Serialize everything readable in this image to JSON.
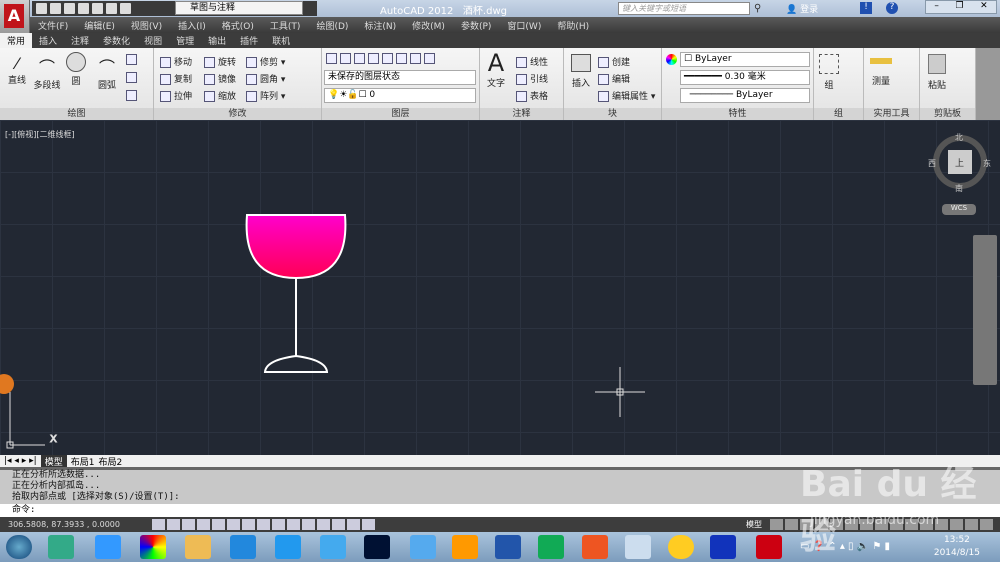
{
  "title": {
    "app": "AutoCAD 2012",
    "file": "酒杯.dwg",
    "workspace": "草图与注释",
    "search_placeholder": "键入关键字或短语",
    "login": "登录"
  },
  "menu": [
    "文件(F)",
    "编辑(E)",
    "视图(V)",
    "插入(I)",
    "格式(O)",
    "工具(T)",
    "绘图(D)",
    "标注(N)",
    "修改(M)",
    "参数(P)",
    "窗口(W)",
    "帮助(H)"
  ],
  "tabs": [
    "常用",
    "插入",
    "注释",
    "参数化",
    "视图",
    "管理",
    "输出",
    "插件",
    "联机"
  ],
  "ribbon": {
    "draw": {
      "title": "绘图",
      "items": [
        "直线",
        "多段线",
        "圆",
        "圆弧"
      ]
    },
    "modify": {
      "title": "修改",
      "items": [
        "移动",
        "旋转",
        "修剪",
        "复制",
        "镜像",
        "圆角",
        "拉伸",
        "缩放",
        "阵列"
      ]
    },
    "layers": {
      "title": "图层",
      "state": "未保存的图层状态",
      "layer": "0"
    },
    "annotation": {
      "title": "注释",
      "text": "文字",
      "items": [
        "线性",
        "引线",
        "表格"
      ]
    },
    "block": {
      "title": "块",
      "insert": "插入",
      "items": [
        "创建",
        "编辑",
        "编辑属性"
      ]
    },
    "properties": {
      "title": "特性",
      "color": "ByLayer",
      "lineweight": "0.30 毫米",
      "linetype": "ByLayer"
    },
    "group": {
      "title": "组",
      "label": "组"
    },
    "utilities": {
      "title": "实用工具",
      "label": "测量"
    },
    "clipboard": {
      "title": "剪贴板",
      "label": "粘贴"
    }
  },
  "viewport": {
    "label": "[-][俯视][二维线框]",
    "compass": {
      "n": "北",
      "s": "南",
      "e": "东",
      "w": "西",
      "top": "上"
    },
    "wcs": "WCS"
  },
  "colors": {
    "glass_top": "#ff00cc",
    "glass_bottom": "#ff0055",
    "canvas": "#222833"
  },
  "layout_tabs": [
    "模型",
    "布局1",
    "布局2"
  ],
  "command": {
    "history": [
      "正在分析所选数据...",
      "正在分析内部孤岛...",
      "拾取内部点或 [选择对象(S)/设置(T)]:"
    ],
    "prompt": "命令:"
  },
  "status": {
    "coords": "306.5808, 87.3933 , 0.0000",
    "model": "模型"
  },
  "clock": {
    "time": "13:52",
    "date": "2014/8/15"
  },
  "watermark": {
    "brand": "Bai du 经验",
    "url": "jingyan.baidu.com"
  }
}
